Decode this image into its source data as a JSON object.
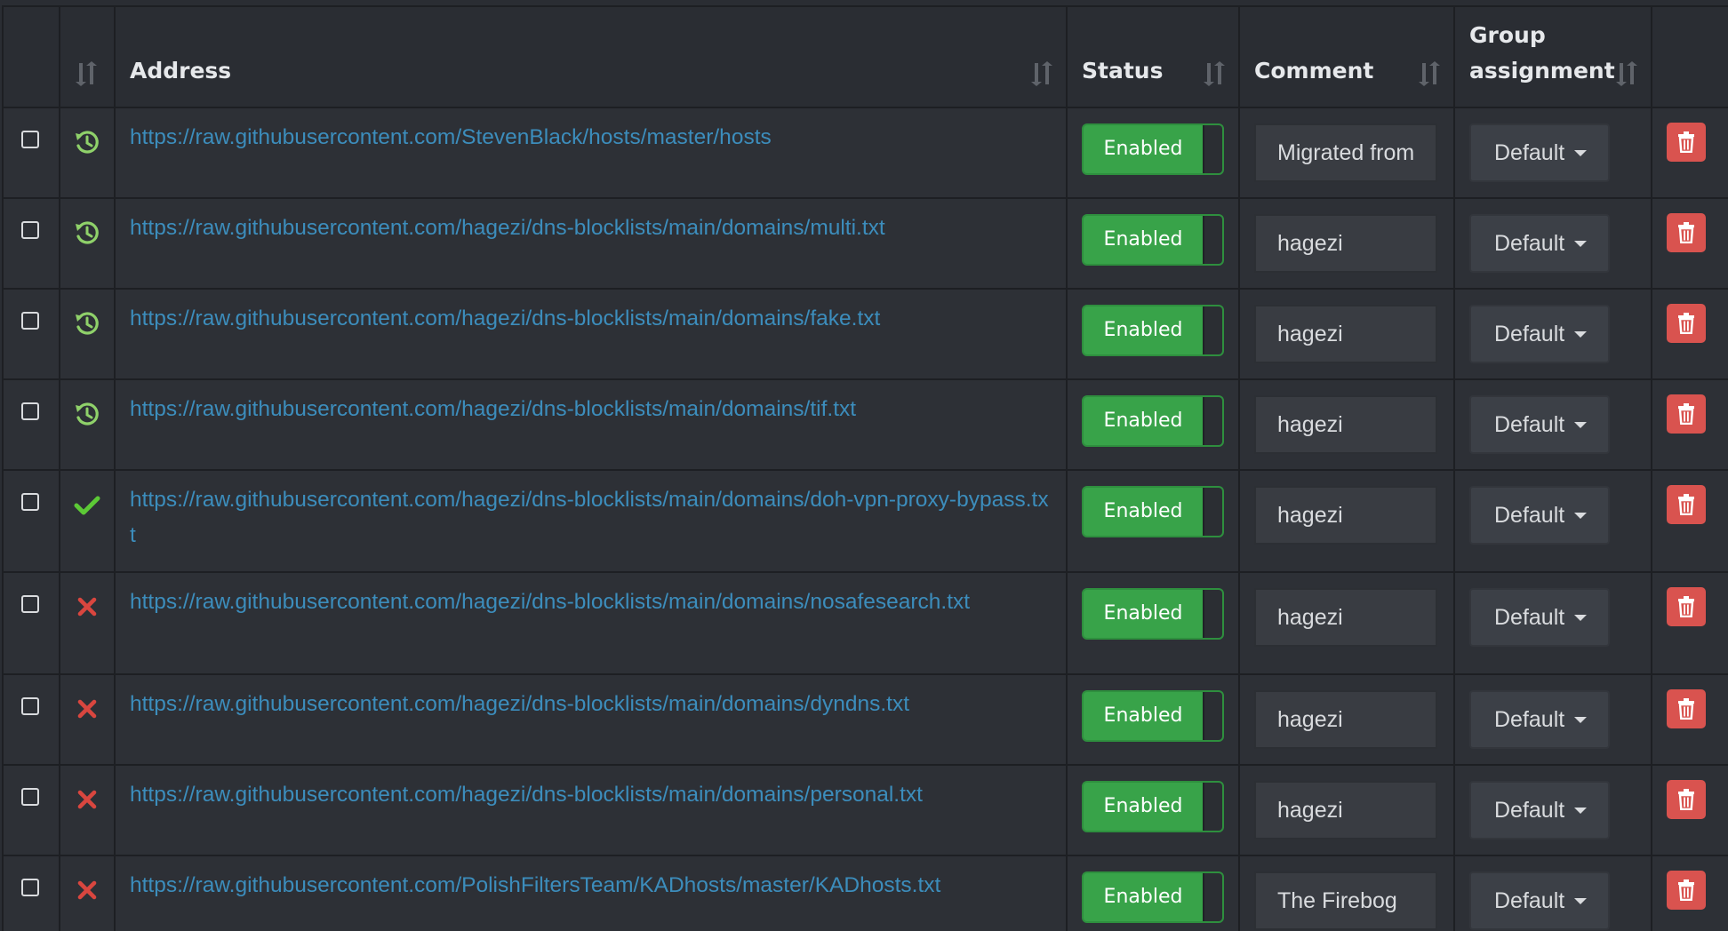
{
  "table": {
    "headers": {
      "address": "Address",
      "status": "Status",
      "comment": "Comment",
      "group_line1": "Group",
      "group_line2": "assignment"
    },
    "icons": {
      "sort": "sort-arrows-icon",
      "pending": "history-icon",
      "ok": "check-icon",
      "error": "x-icon",
      "delete": "trash-icon"
    },
    "colors": {
      "link": "#3c8dbc",
      "enabled": "#38a349",
      "pending": "#8fd16a",
      "ok": "#5cc936",
      "error": "#d9463f",
      "delete": "#d9534f"
    },
    "rows": [
      {
        "status_icon": "pending",
        "address": "https://raw.githubusercontent.com/StevenBlack/hosts/master/hosts",
        "enabled_label": "Enabled",
        "comment": "Migrated from",
        "group": "Default"
      },
      {
        "status_icon": "pending",
        "address": "https://raw.githubusercontent.com/hagezi/dns-blocklists/main/domains/multi.txt",
        "enabled_label": "Enabled",
        "comment": "hagezi",
        "group": "Default"
      },
      {
        "status_icon": "pending",
        "address": "https://raw.githubusercontent.com/hagezi/dns-blocklists/main/domains/fake.txt",
        "enabled_label": "Enabled",
        "comment": "hagezi",
        "group": "Default"
      },
      {
        "status_icon": "pending",
        "address": "https://raw.githubusercontent.com/hagezi/dns-blocklists/main/domains/tif.txt",
        "enabled_label": "Enabled",
        "comment": "hagezi",
        "group": "Default"
      },
      {
        "status_icon": "ok",
        "address": "https://raw.githubusercontent.com/hagezi/dns-blocklists/main/domains/doh-vpn-proxy-bypass.txt",
        "enabled_label": "Enabled",
        "comment": "hagezi",
        "group": "Default"
      },
      {
        "status_icon": "error",
        "address": "https://raw.githubusercontent.com/hagezi/dns-blocklists/main/domains/nosafesearch.txt",
        "enabled_label": "Enabled",
        "comment": "hagezi",
        "group": "Default"
      },
      {
        "status_icon": "error",
        "address": "https://raw.githubusercontent.com/hagezi/dns-blocklists/main/domains/dyndns.txt",
        "enabled_label": "Enabled",
        "comment": "hagezi",
        "group": "Default"
      },
      {
        "status_icon": "error",
        "address": "https://raw.githubusercontent.com/hagezi/dns-blocklists/main/domains/personal.txt",
        "enabled_label": "Enabled",
        "comment": "hagezi",
        "group": "Default"
      },
      {
        "status_icon": "error",
        "address": "https://raw.githubusercontent.com/PolishFiltersTeam/KADhosts/master/KADhosts.txt",
        "enabled_label": "Enabled",
        "comment": "The Firebog",
        "group": "Default"
      }
    ]
  }
}
